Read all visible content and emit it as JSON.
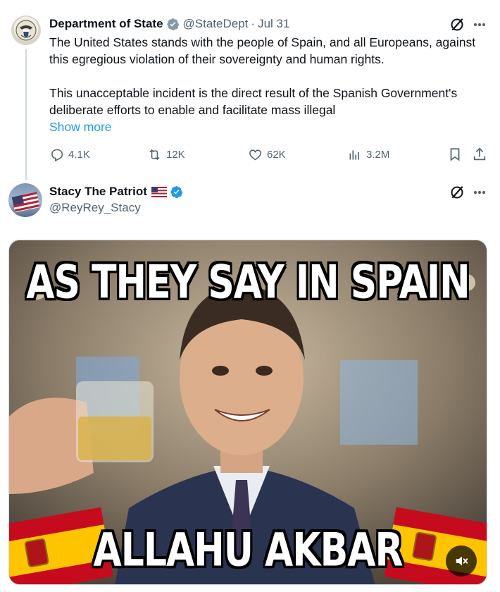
{
  "tweet1": {
    "name": "Department of State",
    "handle": "@StateDept",
    "separator": "·",
    "date": "Jul 31",
    "body_p1": "The United States stands with the people of Spain, and all Europeans, against this egregious violation of their sovereignty and human rights.",
    "body_p2": "This unacceptable incident is the direct result of the Spanish Government's deliberate efforts to enable and facilitate mass illegal",
    "show_more": "Show more",
    "stats": {
      "replies": "4.1K",
      "reposts": "12K",
      "likes": "62K",
      "views": "3.2M"
    },
    "badge_color": "#829aab"
  },
  "tweet2": {
    "name": "Stacy The Patriot",
    "handle": "@ReyRey_Stacy",
    "badge_color": "#1d9bf0",
    "media": {
      "caption_top": "AS THEY SAY IN SPAIN",
      "caption_bottom": "ALLAHU AKBAR",
      "sound_icon": "speaker-muted-icon"
    }
  },
  "colors": {
    "text": "#0f1419",
    "secondary": "#536471",
    "link": "#1d9bf0",
    "thread_line": "#cfd9de"
  },
  "icons": [
    "grok-icon",
    "more-icon",
    "reply-icon",
    "repost-icon",
    "like-icon",
    "views-icon",
    "bookmark-icon",
    "share-icon",
    "verified-badge-icon",
    "us-flag-icon"
  ]
}
